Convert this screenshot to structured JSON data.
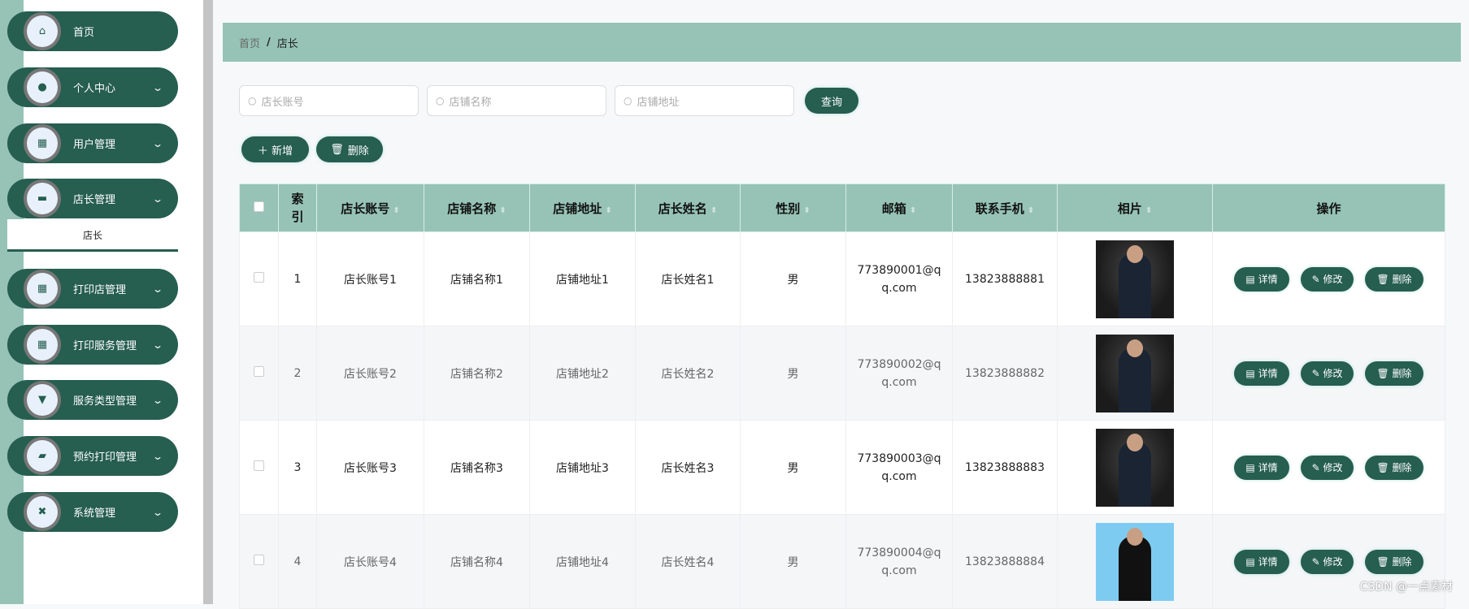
{
  "sidebar": {
    "items": [
      {
        "label": "首页",
        "icon": "home-icon",
        "chev": false
      },
      {
        "label": "个人中心",
        "icon": "user-icon",
        "chev": true
      },
      {
        "label": "用户管理",
        "icon": "grid-icon",
        "chev": true
      },
      {
        "label": "店长管理",
        "icon": "briefcase-icon",
        "chev": true
      },
      {
        "label": "打印店管理",
        "icon": "grid-icon",
        "chev": true
      },
      {
        "label": "打印服务管理",
        "icon": "grid-icon",
        "chev": true
      },
      {
        "label": "服务类型管理",
        "icon": "brush-icon",
        "chev": true
      },
      {
        "label": "预约打印管理",
        "icon": "wallet-icon",
        "chev": true
      },
      {
        "label": "系统管理",
        "icon": "settings-icon",
        "chev": true
      }
    ],
    "submenu": "店长"
  },
  "breadcrumb": {
    "home": "首页",
    "sep": "/",
    "current": "店长"
  },
  "search": {
    "account_placeholder": "店长账号",
    "shop_name_placeholder": "店铺名称",
    "address_placeholder": "店铺地址",
    "query": "查询"
  },
  "toolbar": {
    "add": "＋ 新增",
    "delete": "删除"
  },
  "table": {
    "headers": [
      "索引",
      "店长账号",
      "店铺名称",
      "店铺地址",
      "店长姓名",
      "性别",
      "邮箱",
      "联系手机",
      "相片",
      "操作"
    ],
    "rows": [
      {
        "index": "1",
        "account": "店长账号1",
        "shop": "店铺名称1",
        "address": "店铺地址1",
        "name": "店长姓名1",
        "gender": "男",
        "email": "773890001@qq.com",
        "phone": "13823888881"
      },
      {
        "index": "2",
        "account": "店长账号2",
        "shop": "店铺名称2",
        "address": "店铺地址2",
        "name": "店长姓名2",
        "gender": "男",
        "email": "773890002@qq.com",
        "phone": "13823888882"
      },
      {
        "index": "3",
        "account": "店长账号3",
        "shop": "店铺名称3",
        "address": "店铺地址3",
        "name": "店长姓名3",
        "gender": "男",
        "email": "773890003@qq.com",
        "phone": "13823888883"
      },
      {
        "index": "4",
        "account": "店长账号4",
        "shop": "店铺名称4",
        "address": "店铺地址4",
        "name": "店长姓名4",
        "gender": "男",
        "email": "773890004@qq.com",
        "phone": "13823888884"
      }
    ],
    "actions": {
      "detail": "详情",
      "edit": "修改",
      "delete": "删除"
    }
  },
  "watermark": "CSDN @一点素材"
}
